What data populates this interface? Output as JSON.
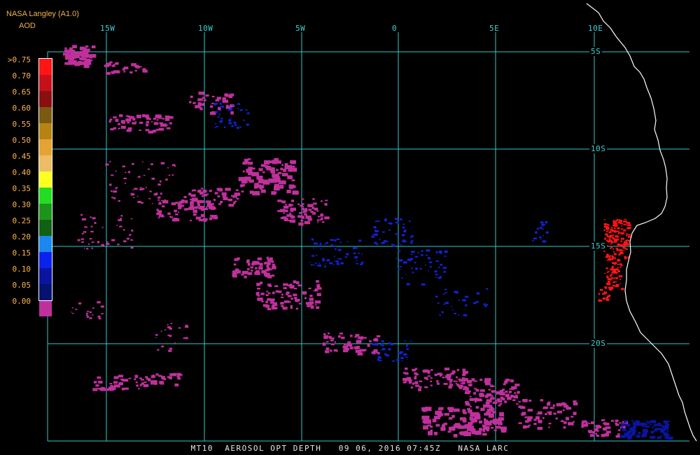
{
  "header": {
    "source": "NASA Langley (A1.0)",
    "product": "AOD"
  },
  "legend": {
    "labels": [
      ">0.75",
      "0.70",
      "0.65",
      "0.60",
      "0.55",
      "0.50",
      "0.45",
      "0.40",
      "0.35",
      "0.30",
      "0.25",
      "0.20",
      "0.15",
      "0.10",
      "0.05",
      "0.00"
    ],
    "colors": [
      "#ff1515",
      "#c8101a",
      "#8a0f10",
      "#7a5a10",
      "#b58412",
      "#e3a433",
      "#ecbd64",
      "#ffff20",
      "#22dd22",
      "#1a951a",
      "#116014",
      "#1a88ee",
      "#0a22ee",
      "#0a14a0",
      "#061270",
      "#c0309c"
    ]
  },
  "map": {
    "lon_labels": [
      "15W",
      "10W",
      "5W",
      "0",
      "5E",
      "10E"
    ],
    "lat_labels": [
      "5S",
      "10S",
      "15S",
      "20S"
    ],
    "grid_color": "#36c8c8",
    "coast_color": "#ffffff"
  },
  "footer": {
    "text": "MT10  AEROSOL OPT DEPTH   09 06, 2016 07:45Z   NASA LARC"
  }
}
